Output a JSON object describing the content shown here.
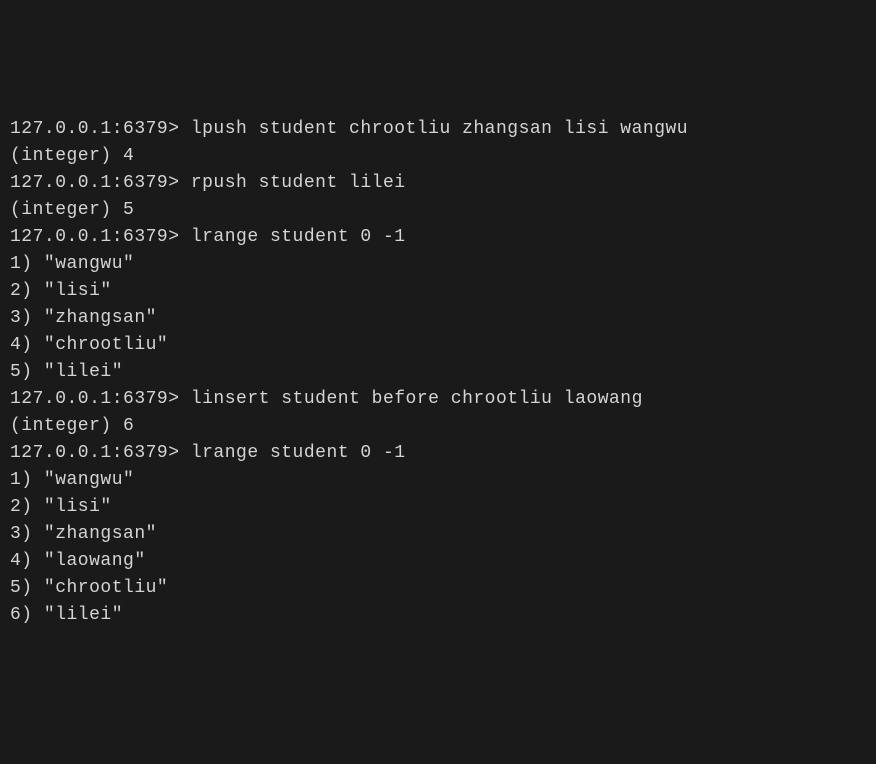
{
  "terminal": {
    "prompt": "127.0.0.1:6379>",
    "lines": [
      {
        "type": "command",
        "text": "lpush student chrootliu zhangsan lisi wangwu"
      },
      {
        "type": "output",
        "text": "(integer) 4"
      },
      {
        "type": "command",
        "text": "rpush student lilei"
      },
      {
        "type": "output",
        "text": "(integer) 5"
      },
      {
        "type": "command",
        "text": "lrange student 0 -1"
      },
      {
        "type": "output",
        "text": "1) \"wangwu\""
      },
      {
        "type": "output",
        "text": "2) \"lisi\""
      },
      {
        "type": "output",
        "text": "3) \"zhangsan\""
      },
      {
        "type": "output",
        "text": "4) \"chrootliu\""
      },
      {
        "type": "output",
        "text": "5) \"lilei\""
      },
      {
        "type": "command",
        "text": "linsert student before chrootliu laowang"
      },
      {
        "type": "output",
        "text": "(integer) 6"
      },
      {
        "type": "command",
        "text": "lrange student 0 -1"
      },
      {
        "type": "output",
        "text": "1) \"wangwu\""
      },
      {
        "type": "output",
        "text": "2) \"lisi\""
      },
      {
        "type": "output",
        "text": "3) \"zhangsan\""
      },
      {
        "type": "output",
        "text": "4) \"laowang\""
      },
      {
        "type": "output",
        "text": "5) \"chrootliu\""
      },
      {
        "type": "output",
        "text": "6) \"lilei\""
      }
    ]
  }
}
